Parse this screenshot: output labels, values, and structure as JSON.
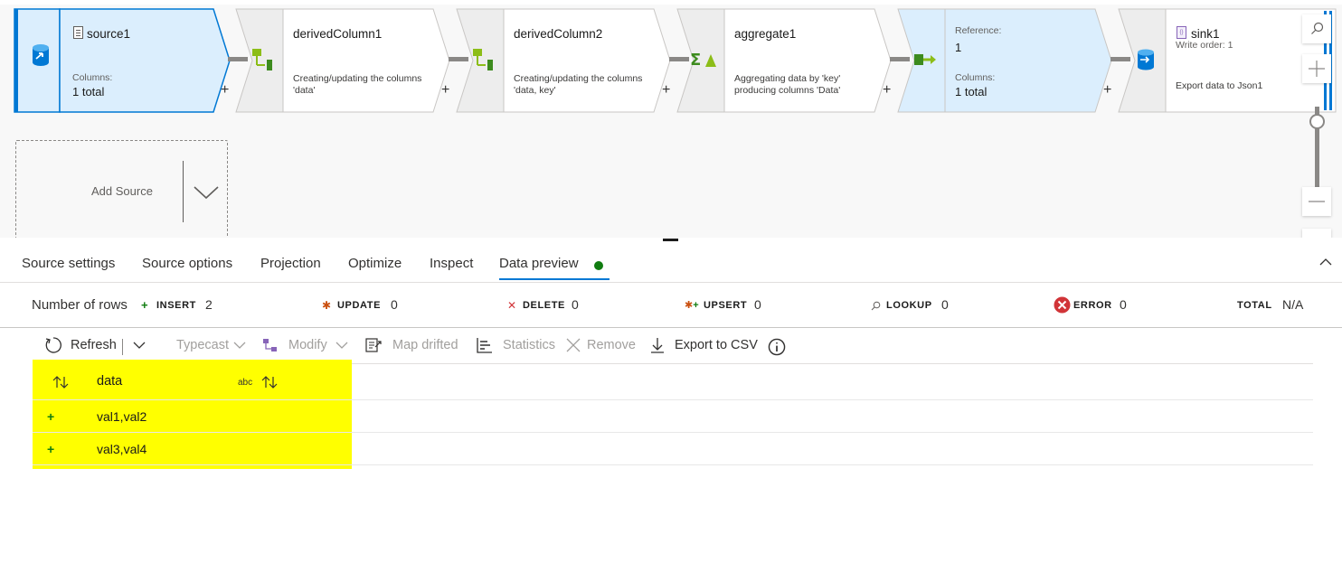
{
  "pipeline": {
    "nodes": [
      {
        "id": "source1",
        "title": "source1",
        "columns_label": "Columns:",
        "columns_value": "1 total"
      },
      {
        "id": "derivedColumn1",
        "title": "derivedColumn1",
        "description": [
          "Creating/updating the columns",
          "'data'"
        ]
      },
      {
        "id": "derivedColumn2",
        "title": "derivedColumn2",
        "description": [
          "Creating/updating the columns",
          "'data, key'"
        ]
      },
      {
        "id": "aggregate1",
        "title": "aggregate1",
        "description": [
          "Aggregating data by 'key'",
          "producing columns 'Data'"
        ]
      },
      {
        "id": "select",
        "reference_label": "Reference:",
        "reference_value": "1",
        "columns_label": "Columns:",
        "columns_value": "1 total"
      },
      {
        "id": "sink1",
        "title": "sink1",
        "subtitle": "Write order: 1",
        "description": "Export data to Json1"
      }
    ],
    "add_source_label": "Add Source"
  },
  "tabs": [
    {
      "label": "Source settings"
    },
    {
      "label": "Source options"
    },
    {
      "label": "Projection"
    },
    {
      "label": "Optimize"
    },
    {
      "label": "Inspect"
    },
    {
      "label": "Data preview",
      "active": true
    }
  ],
  "stats": {
    "rows_label": "Number of rows",
    "insert": {
      "label": "INSERT",
      "value": "2"
    },
    "update": {
      "label": "UPDATE",
      "value": "0"
    },
    "delete": {
      "label": "DELETE",
      "value": "0"
    },
    "upsert": {
      "label": "UPSERT",
      "value": "0"
    },
    "lookup": {
      "label": "LOOKUP",
      "value": "0"
    },
    "error": {
      "label": "ERROR",
      "value": "0"
    },
    "total": {
      "label": "TOTAL",
      "value": "N/A"
    }
  },
  "toolbar": {
    "refresh": "Refresh",
    "typecast": "Typecast",
    "modify": "Modify",
    "map_drifted": "Map drifted",
    "statistics": "Statistics",
    "remove": "Remove",
    "export_csv": "Export to CSV"
  },
  "grid": {
    "column": {
      "name": "data",
      "type": "abc"
    },
    "rows": [
      {
        "indicator": "+",
        "data": "val1,val2"
      },
      {
        "indicator": "+",
        "data": "val3,val4"
      }
    ]
  },
  "colors": {
    "accent": "#0078d4",
    "selected_node": "#dbeefd",
    "insert": "#107c10",
    "error": "#d13438",
    "highlight": "#ffff00"
  }
}
